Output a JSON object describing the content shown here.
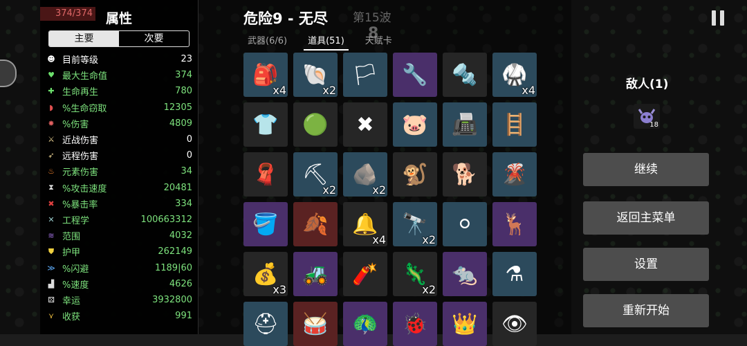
{
  "player_hp": "374/374",
  "stats": {
    "title": "属性",
    "tabs": [
      "主要",
      "次要"
    ],
    "rows": [
      {
        "icon": "level-icon",
        "name": "目前等级",
        "value": "23",
        "color": "#ffffff"
      },
      {
        "icon": "heart-icon",
        "name": "最大生命值",
        "value": "374",
        "color": "#7de27d"
      },
      {
        "icon": "regen-icon",
        "name": "生命再生",
        "value": "780",
        "color": "#7de27d"
      },
      {
        "icon": "steal-icon",
        "name": "%生命窃取",
        "value": "12305",
        "color": "#7de27d"
      },
      {
        "icon": "damage-icon",
        "name": "%伤害",
        "value": "4809",
        "color": "#7de27d"
      },
      {
        "icon": "melee-icon",
        "name": "近战伤害",
        "value": "0",
        "color": "#ffffff"
      },
      {
        "icon": "ranged-icon",
        "name": "远程伤害",
        "value": "0",
        "color": "#ffffff"
      },
      {
        "icon": "fire-icon",
        "name": "元素伤害",
        "value": "34",
        "color": "#7de27d"
      },
      {
        "icon": "hourglass-icon",
        "name": "%攻击速度",
        "value": "20481",
        "color": "#7de27d"
      },
      {
        "icon": "crit-icon",
        "name": "%暴击率",
        "value": "334",
        "color": "#7de27d"
      },
      {
        "icon": "wrench-icon",
        "name": "工程学",
        "value": "100663312",
        "color": "#7de27d"
      },
      {
        "icon": "range-icon",
        "name": "范围",
        "value": "4032",
        "color": "#7de27d"
      },
      {
        "icon": "shield-icon",
        "name": "护甲",
        "value": "262149",
        "color": "#7de27d"
      },
      {
        "icon": "dodge-icon",
        "name": "%闪避",
        "value": "1189|60",
        "color": "#7de27d"
      },
      {
        "icon": "boot-icon",
        "name": "%速度",
        "value": "4626",
        "color": "#7de27d"
      },
      {
        "icon": "dice-icon",
        "name": "幸运",
        "value": "3932800",
        "color": "#7de27d"
      },
      {
        "icon": "harvest-icon",
        "name": "收获",
        "value": "991",
        "color": "#7de27d"
      }
    ]
  },
  "header": {
    "title": "危险9 - 无尽",
    "wave": "第15波",
    "wave_number": "8"
  },
  "item_tabs": [
    {
      "label": "武器(6/6)",
      "active": false
    },
    {
      "label": "道具(51)",
      "active": true
    },
    {
      "label": "天赋卡",
      "active": false
    }
  ],
  "items": [
    {
      "name": "padlock-item",
      "tier": "blue",
      "qty": "x4",
      "glyph": "🎒"
    },
    {
      "name": "scythe-snail-item",
      "tier": "blue",
      "qty": "x2",
      "glyph": "🐚"
    },
    {
      "name": "white-flag-item",
      "tier": "blue",
      "qty": "",
      "glyph": "🏳"
    },
    {
      "name": "tools-item",
      "tier": "purple",
      "qty": "",
      "glyph": "🔧"
    },
    {
      "name": "whistle-item",
      "tier": "dark",
      "qty": "",
      "glyph": "🔩"
    },
    {
      "name": "black-belt-item",
      "tier": "blue",
      "qty": "x4",
      "glyph": "🥋"
    },
    {
      "name": "plaid-shirt-item",
      "tier": "dark",
      "qty": "",
      "glyph": "👕"
    },
    {
      "name": "green-slime-item",
      "tier": "dark",
      "qty": "",
      "glyph": "🟢"
    },
    {
      "name": "claw-item",
      "tier": "dark",
      "qty": "",
      "glyph": "✖"
    },
    {
      "name": "piggy-bank-item",
      "tier": "blue",
      "qty": "",
      "glyph": "🐷"
    },
    {
      "name": "cash-machine-item",
      "tier": "blue",
      "qty": "",
      "glyph": "📠"
    },
    {
      "name": "green-stairs-item",
      "tier": "blue",
      "qty": "",
      "glyph": "🪜"
    },
    {
      "name": "red-scarf-item",
      "tier": "dark",
      "qty": "",
      "glyph": "🧣"
    },
    {
      "name": "shovel-item",
      "tier": "blue",
      "qty": "x2",
      "glyph": "⛏"
    },
    {
      "name": "rock-item",
      "tier": "blue",
      "qty": "x2",
      "glyph": "🪨"
    },
    {
      "name": "monkey-item",
      "tier": "dark",
      "qty": "",
      "glyph": "🐒"
    },
    {
      "name": "dog-item",
      "tier": "dark",
      "qty": "",
      "glyph": "🐕"
    },
    {
      "name": "volcano-item",
      "tier": "blue",
      "qty": "",
      "glyph": "🌋"
    },
    {
      "name": "bucket-item",
      "tier": "purple",
      "qty": "",
      "glyph": "🪣"
    },
    {
      "name": "rainbow-leaf-item",
      "tier": "red",
      "qty": "",
      "glyph": "🍂"
    },
    {
      "name": "gadget-item",
      "tier": "dark",
      "qty": "x4",
      "glyph": "🔔"
    },
    {
      "name": "spyglass-item",
      "tier": "blue",
      "qty": "x2",
      "glyph": "🔭"
    },
    {
      "name": "snowball-item",
      "tier": "blue",
      "qty": "",
      "glyph": "⚪"
    },
    {
      "name": "antler-skull-item",
      "tier": "purple",
      "qty": "",
      "glyph": "🦌"
    },
    {
      "name": "sack-item",
      "tier": "dark",
      "qty": "x3",
      "glyph": "💰"
    },
    {
      "name": "tractor-item",
      "tier": "purple",
      "qty": "",
      "glyph": "🚜"
    },
    {
      "name": "dynamite-item",
      "tier": "dark",
      "qty": "",
      "glyph": "🧨"
    },
    {
      "name": "lizard-item",
      "tier": "dark",
      "qty": "x2",
      "glyph": "🦎"
    },
    {
      "name": "rat-item",
      "tier": "purple",
      "qty": "",
      "glyph": "🐀"
    },
    {
      "name": "potion-item",
      "tier": "blue",
      "qty": "",
      "glyph": "⚗"
    },
    {
      "name": "medkit-item",
      "tier": "blue",
      "qty": "",
      "glyph": "⛑"
    },
    {
      "name": "drum-item",
      "tier": "red",
      "qty": "",
      "glyph": "🥁"
    },
    {
      "name": "peacock-item",
      "tier": "purple",
      "qty": "",
      "glyph": "🦚"
    },
    {
      "name": "bug-item",
      "tier": "purple",
      "qty": "",
      "glyph": "🐞"
    },
    {
      "name": "crown-item",
      "tier": "purple",
      "qty": "",
      "glyph": "👑"
    },
    {
      "name": "eyeball-item",
      "tier": "dark",
      "qty": "",
      "glyph": "👁"
    }
  ],
  "enemies": {
    "label": "敌人(1)",
    "count": "18"
  },
  "buttons": {
    "continue": "继续",
    "main_menu": "返回主菜单",
    "settings": "设置",
    "restart": "重新开始"
  }
}
